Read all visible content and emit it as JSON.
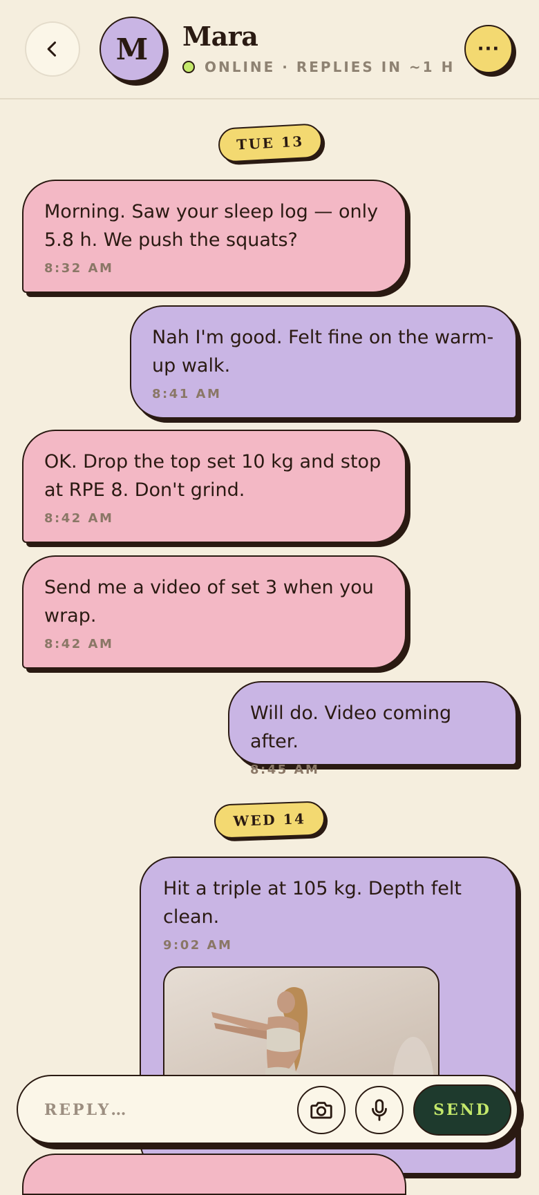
{
  "header": {
    "back_icon": "chevron-left-icon",
    "avatar_initial": "M",
    "name": "Mara",
    "status": "ONLINE · REPLIES IN ~1 H",
    "more_icon": "more-dots-icon",
    "more_label": "···"
  },
  "days": [
    {
      "label": "TUE 13"
    },
    {
      "label": "WED 14"
    }
  ],
  "messages": [
    {
      "from": "coach",
      "text": "Morning. Saw your sleep log — only 5.8 h. We push the squats?",
      "time": "8:32 AM"
    },
    {
      "from": "me",
      "text": "Nah I'm good. Felt fine on the warm-up walk.",
      "time": "8:41 AM"
    },
    {
      "from": "coach",
      "text": "OK. Drop the top set 10 kg and stop at RPE 8. Don't grind.",
      "time": "8:42 AM"
    },
    {
      "from": "coach",
      "text": "Send me a video of set 3 when you wrap.",
      "time": "8:42 AM"
    },
    {
      "from": "me",
      "text": "Will do. Video coming after.",
      "time": "8:45 AM"
    },
    {
      "from": "me",
      "text": "Hit a triple at 105 kg. Depth felt clean.",
      "time": "9:02 AM",
      "attachment": "photo"
    }
  ],
  "composer": {
    "placeholder": "REPLY…",
    "camera_icon": "camera-icon",
    "mic_icon": "microphone-icon",
    "send_label": "SEND"
  },
  "colors": {
    "background": "#f5eede",
    "coach_bubble": "#f3b8c5",
    "my_bubble": "#c9b5e4",
    "accent_yellow": "#f3d971",
    "send_bg": "#1e3a2d",
    "send_text": "#c4e86b",
    "outline": "#2a1a12"
  }
}
